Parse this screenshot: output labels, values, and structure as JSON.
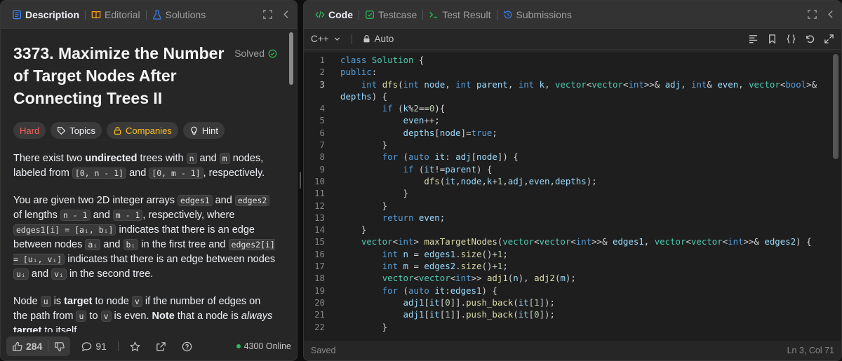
{
  "left_tabs": {
    "description": "Description",
    "editorial": "Editorial",
    "solutions": "Solutions"
  },
  "problem": {
    "title": "3373. Maximize the Number of Target Nodes After Connecting Trees II",
    "status": "Solved",
    "tags": {
      "difficulty": "Hard",
      "topics": "Topics",
      "companies": "Companies",
      "hint": "Hint"
    }
  },
  "description_text": {
    "p1_a": "There exist two ",
    "p1_b": "undirected",
    "p1_c": " trees with ",
    "p1_n": "n",
    "p1_d": " and ",
    "p1_m": "m",
    "p1_e": " nodes, labeled from ",
    "p1_r1": "[0, n - 1]",
    "p1_f": " and ",
    "p1_r2": "[0, m - 1]",
    "p1_g": ", respectively.",
    "p2_a": "You are given two 2D integer arrays ",
    "p2_e1": "edges1",
    "p2_b": " and ",
    "p2_e2": "edges2",
    "p2_c": " of lengths ",
    "p2_n1": "n - 1",
    "p2_d": " and ",
    "p2_m1": "m - 1",
    "p2_e": ", respectively, where ",
    "p2_e1i": "edges1[i] = [aᵢ, bᵢ]",
    "p2_f": " indicates that there is an edge between nodes ",
    "p2_ai": "aᵢ",
    "p2_g": " and ",
    "p2_bi": "bᵢ",
    "p2_h": " in the first tree and ",
    "p2_e2i": "edges2[i] = [uᵢ, vᵢ]",
    "p2_i": " indicates that there is an edge between nodes ",
    "p2_ui": "uᵢ",
    "p2_j": " and ",
    "p2_vi": "vᵢ",
    "p2_k": " in the second tree.",
    "p3_a": "Node ",
    "p3_u": "u",
    "p3_b": " is ",
    "p3_target": "target",
    "p3_c": " to node ",
    "p3_v": "v",
    "p3_d": " if the number of edges on the path from ",
    "p3_u2": "u",
    "p3_e": " to ",
    "p3_v2": "v",
    "p3_f": " is even. ",
    "p3_note": "Note",
    "p3_g": " that a node is ",
    "p3_always": "always",
    "p3_h": " ",
    "p3_target2": "target",
    "p3_i": " to itself."
  },
  "left_footer": {
    "likes": "284",
    "comments": "91",
    "online": "4300 Online"
  },
  "right_tabs": {
    "code": "Code",
    "testcase": "Testcase",
    "test_result": "Test Result",
    "submissions": "Submissions"
  },
  "editor_toolbar": {
    "language": "C++",
    "mode": "Auto"
  },
  "status_bar": {
    "saved": "Saved",
    "position": "Ln 3, Col 71"
  },
  "code_lines": [
    "1",
    "2",
    "3",
    "4",
    "5",
    "6",
    "7",
    "8",
    "9",
    "10",
    "11",
    "12",
    "13",
    "14",
    "15",
    "16",
    "17",
    "18",
    "19",
    "20",
    "21",
    "22"
  ],
  "colors": {
    "hard": "#f8615c",
    "companies": "#ffc01e",
    "solved_check": "#2cbb5d",
    "keyword": "#569cd6",
    "online_dot": "#2cbb5d"
  }
}
